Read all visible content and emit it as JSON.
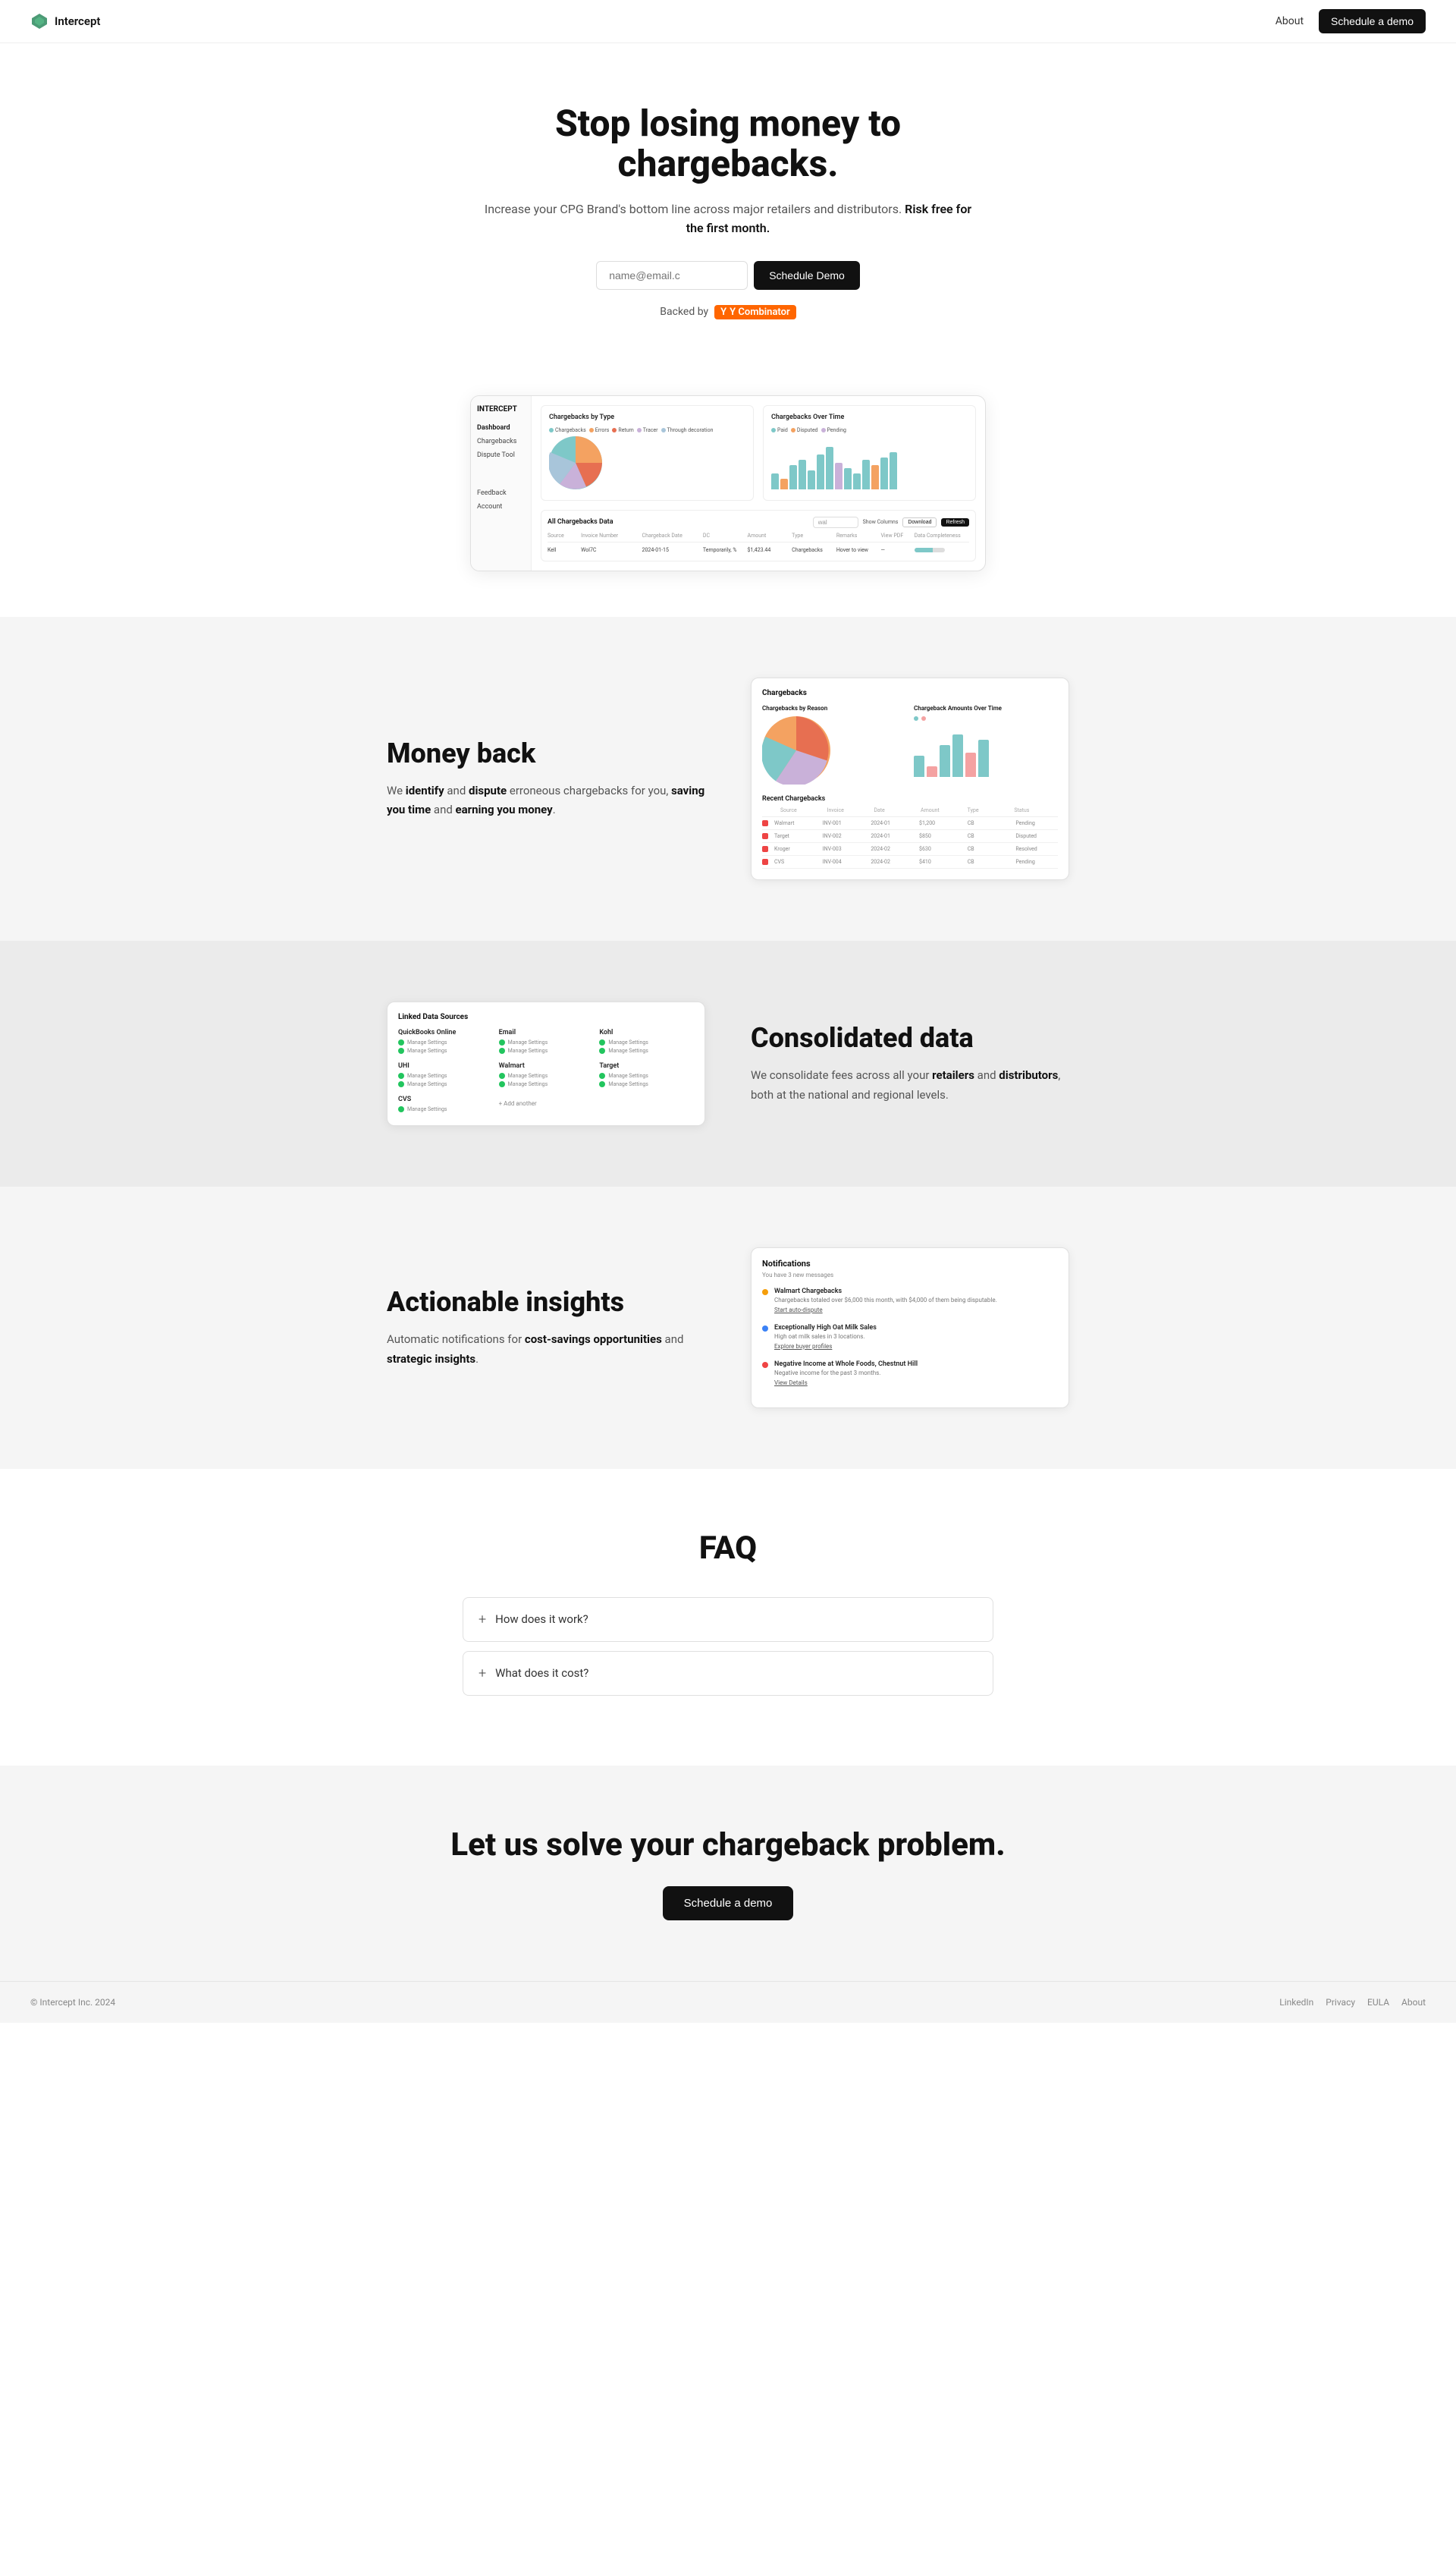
{
  "nav": {
    "logo_text": "Intercept",
    "about_label": "About",
    "demo_btn_label": "Schedule a demo"
  },
  "hero": {
    "headline": "Stop losing money to chargebacks.",
    "subtext": "Increase your CPG Brand's bottom line across major retailers and distributors.",
    "subtext_bold": "Risk free for the first month.",
    "email_placeholder": "name@email.c",
    "cta_label": "Schedule Demo",
    "backed_by_label": "Backed by",
    "yc_label": "Y Combinator"
  },
  "dashboard_mock": {
    "sidebar_logo": "INTERCEPT",
    "sidebar_items": [
      "Dashboard",
      "Chargebacks",
      "Dispute Tool"
    ],
    "sidebar_footer_items": [
      "Feedback",
      "Account"
    ],
    "chart1_title": "Chargebacks by Type",
    "chart2_title": "Chargebacks Over Time",
    "table_title": "All Chargebacks Data",
    "search_placeholder": "wal",
    "table_columns": [
      "Source",
      "Invoice Number",
      "Chargeback Date",
      "DC",
      "Amount",
      "Type",
      "Remarks",
      "View PDF",
      "Data Completeness"
    ],
    "table_row": [
      "Kell",
      "Wol7C",
      "2024-01-15",
      "Temporarily, %",
      "$1,423.44",
      "Chargebacks",
      "Hover to view"
    ],
    "btn_download": "Download",
    "btn_refresh": "Refresh",
    "show_columns_label": "Show Columns"
  },
  "feature1": {
    "title": "Money back",
    "para1": "We ",
    "identify": "identify",
    "and_text": " and ",
    "dispute": "dispute",
    "para2": " erroneous chargebacks for you, ",
    "saving_time": "saving you time",
    "and2": " and ",
    "earning": "earning you money",
    "period": ".",
    "mock_title": "Chargebacks",
    "pie_title": "Chargebacks by Reason",
    "bar_title": "Chargeback Amounts Over Time",
    "recent_title": "Recent Chargebacks"
  },
  "feature2": {
    "title": "Consolidated data",
    "para": "We consolidate fees across all your ",
    "retailers": "retailers",
    "and_text": " and ",
    "distributors": "distributors",
    "rest": ", both at the national and regional levels.",
    "mock_title": "Linked Data Sources",
    "sources": [
      {
        "name": "QuickBooks Online",
        "status": "green"
      },
      {
        "name": "Email",
        "status": "green"
      },
      {
        "name": "Kohl",
        "status": "green"
      },
      {
        "name": "UHI",
        "status": "green"
      },
      {
        "name": "Walmart",
        "status": "green"
      },
      {
        "name": "Target",
        "status": "green"
      },
      {
        "name": "CVS",
        "status": "green"
      }
    ],
    "add_another": "+ Add another"
  },
  "feature3": {
    "title": "Actionable insights",
    "para1": "Automatic notifications for ",
    "cost_savings": "cost-savings opportunities",
    "and_text": " and ",
    "strategic": "strategic insights",
    "period": ".",
    "mock_title": "Notifications",
    "mock_subtitle": "You have 3 new messages",
    "notifications": [
      {
        "color": "yellow",
        "title": "Walmart Chargebacks",
        "desc": "Chargebacks totaled over $6,000 this month, with $4,000 of them being disputable.",
        "action": "Start auto-dispute"
      },
      {
        "color": "blue",
        "title": "Exceptionally High Oat Milk Sales",
        "desc": "High oat milk sales in 3 locations.",
        "action": "Explore buyer profiles"
      },
      {
        "color": "red",
        "title": "Negative Income at Whole Foods, Chestnut Hill",
        "desc": "Negative income for the past 3 months.",
        "action": "View Details"
      }
    ]
  },
  "faq": {
    "title": "FAQ",
    "items": [
      {
        "question": "How does it work?"
      },
      {
        "question": "What does it cost?"
      }
    ]
  },
  "cta": {
    "headline": "Let us solve your chargeback problem.",
    "btn_label": "Schedule a demo"
  },
  "footer": {
    "copy": "© Intercept Inc. 2024",
    "links": [
      "LinkedIn",
      "Privacy",
      "EULA",
      "About"
    ]
  },
  "colors": {
    "pie1": "#7ec8c8",
    "pie2": "#f4a261",
    "pie3": "#e76f51",
    "pie4": "#a8c5da",
    "pie5": "#c9b1d9",
    "bar_teal": "#7ec8c8",
    "bar_pink": "#f4a2a2",
    "accent": "#111111",
    "brand_green": "#22c55e"
  }
}
